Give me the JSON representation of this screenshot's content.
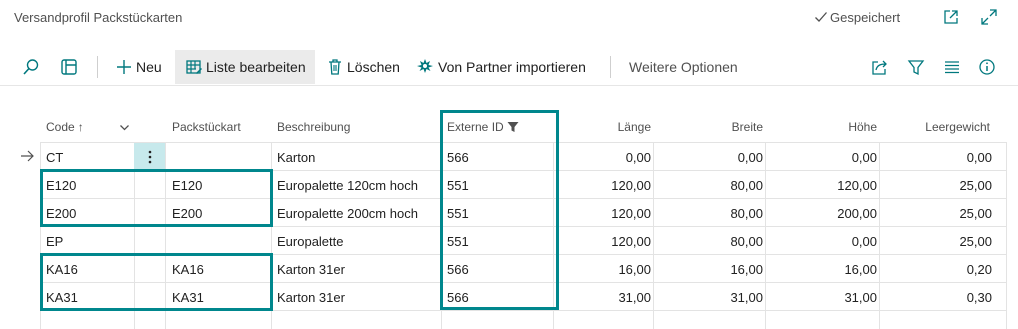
{
  "window": {
    "title": "Versandprofil Packstückarten",
    "saved_label": "Gespeichert",
    "icons": [
      "open-new-window-icon",
      "expand-icon"
    ]
  },
  "actionbar": {
    "new_label": "Neu",
    "edit_list_label": "Liste bearbeiten",
    "delete_label": "Löschen",
    "import_label": "Von Partner importieren",
    "more_label": "Weitere Optionen",
    "icons": [
      "search-icon",
      "filter-pane-icon",
      "share-icon",
      "filter-icon",
      "list-view-icon",
      "info-icon"
    ]
  },
  "table": {
    "headers": {
      "code": "Code",
      "sort_indicator": "↑",
      "package_type": "Packstückart",
      "description": "Beschreibung",
      "external_id": "Externe ID",
      "length": "Länge",
      "width": "Breite",
      "height": "Höhe",
      "tare_weight": "Leergewicht"
    },
    "rows": [
      {
        "code": "CT",
        "package_type": "",
        "description": "Karton",
        "external_id": "566",
        "length": "0,00",
        "width": "0,00",
        "height": "0,00",
        "tare_weight": "0,00",
        "selected": true
      },
      {
        "code": "E120",
        "package_type": "E120",
        "description": "Europalette 120cm hoch",
        "external_id": "551",
        "length": "120,00",
        "width": "80,00",
        "height": "120,00",
        "tare_weight": "25,00"
      },
      {
        "code": "E200",
        "package_type": "E200",
        "description": "Europalette 200cm hoch",
        "external_id": "551",
        "length": "120,00",
        "width": "80,00",
        "height": "200,00",
        "tare_weight": "25,00"
      },
      {
        "code": "EP",
        "package_type": "",
        "description": "Europalette",
        "external_id": "551",
        "length": "120,00",
        "width": "80,00",
        "height": "0,00",
        "tare_weight": "25,00"
      },
      {
        "code": "KA16",
        "package_type": "KA16",
        "description": "Karton 31er",
        "external_id": "566",
        "length": "16,00",
        "width": "16,00",
        "height": "16,00",
        "tare_weight": "0,20"
      },
      {
        "code": "KA31",
        "package_type": "KA31",
        "description": "Karton 31er",
        "external_id": "566",
        "length": "31,00",
        "width": "31,00",
        "height": "31,00",
        "tare_weight": "0,30"
      }
    ]
  },
  "colors": {
    "highlight": "#00878d",
    "accent": "#00787e",
    "selected_cell": "#c7e9ec"
  }
}
